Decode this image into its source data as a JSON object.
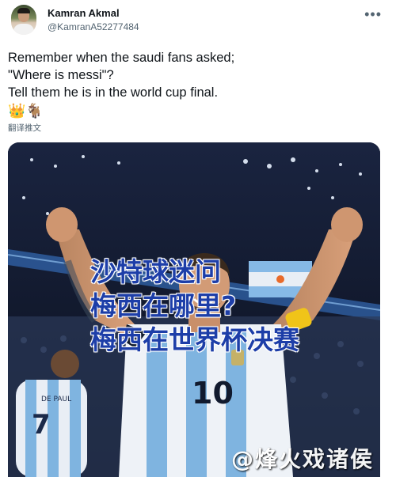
{
  "tweet": {
    "author_name": "Kamran Akmal",
    "author_handle": "@KamranA52277484",
    "more_icon": "more-horizontal-icon",
    "text": "Remember when the saudi fans asked;\n\"Where is messi\"?\nTell them he is in the world cup final.",
    "emojis": [
      "👑",
      "🐐"
    ],
    "translate_label": "翻译推文"
  },
  "media": {
    "caption_lines": [
      "沙特球迷问",
      "梅西在哪里?",
      "梅西在世界杯决赛"
    ],
    "jersey_number_main": "10",
    "jersey_number_back": "7",
    "back_player_name": "DE PAUL",
    "watermark": "@烽火戏诸侯"
  },
  "colors": {
    "caption": "#1d3ea8",
    "argentina_blue": "#7fb4e0",
    "captain_band": "#f0c419"
  }
}
